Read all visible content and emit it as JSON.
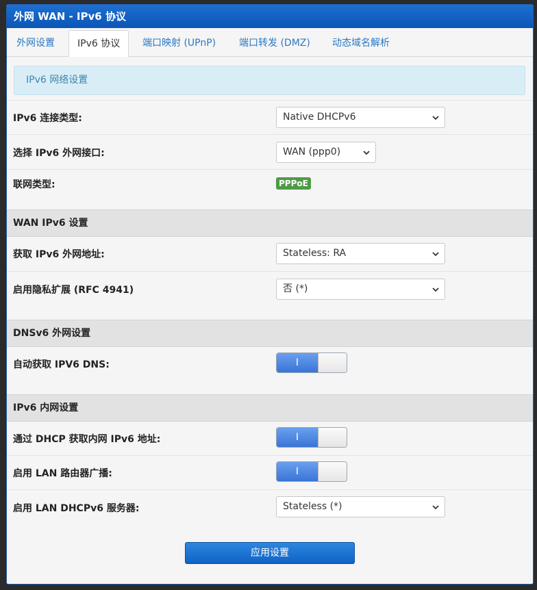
{
  "header": {
    "title": "外网 WAN - IPv6 协议"
  },
  "tabs": [
    {
      "label": "外网设置"
    },
    {
      "label": "IPv6 协议"
    },
    {
      "label": "端口映射 (UPnP)"
    },
    {
      "label": "端口转发 (DMZ)"
    },
    {
      "label": "动态域名解析"
    }
  ],
  "info": {
    "text": "IPv6 网络设置"
  },
  "general": {
    "conn_type_label": "IPv6 连接类型:",
    "conn_type_value": "Native DHCPv6",
    "wan_iface_label": "选择 IPv6 外网接口:",
    "wan_iface_value": "WAN (ppp0)",
    "net_type_label": "联网类型:",
    "net_type_badge": "PPPoE"
  },
  "wan_ipv6": {
    "title": "WAN IPv6 设置",
    "addr_label": "获取 IPv6 外网地址:",
    "addr_value": "Stateless: RA",
    "privacy_label": "启用隐私扩展 (RFC 4941)",
    "privacy_value": "否 (*)"
  },
  "dnsv6": {
    "title": "DNSv6 外网设置",
    "auto_dns_label": "自动获取 IPV6 DNS:",
    "auto_dns_on": "I"
  },
  "lan_ipv6": {
    "title": "IPv6 内网设置",
    "dhcp_addr_label": "通过 DHCP 获取内网 IPv6 地址:",
    "dhcp_addr_on": "I",
    "router_adv_label": "启用 LAN 路由器广播:",
    "router_adv_on": "I",
    "dhcpv6_server_label": "启用 LAN DHCPv6 服务器:",
    "dhcpv6_server_value": "Stateless (*)"
  },
  "footer": {
    "apply_label": "应用设置"
  },
  "colors": {
    "header_blue": "#0b56b6",
    "tab_link": "#2a78c4",
    "info_bg": "#d9edf7",
    "badge_green": "#4f9a45",
    "toggle_blue": "#3a74d6"
  }
}
